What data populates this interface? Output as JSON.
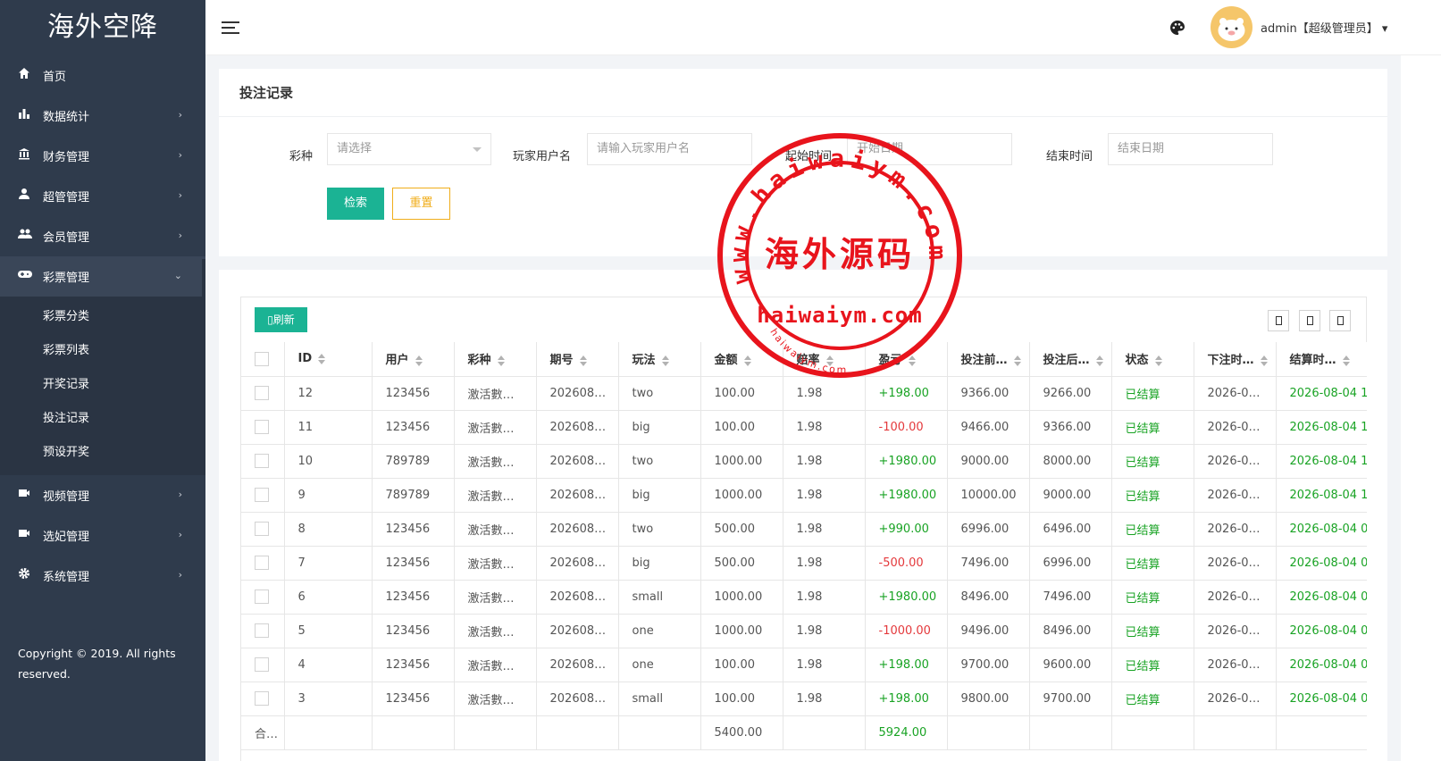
{
  "brand": "海外空降",
  "sidebar": {
    "items": [
      {
        "label": "首页",
        "icon": "home-icon",
        "arrow": ""
      },
      {
        "label": "数据统计",
        "icon": "bar-chart-icon",
        "arrow": "›"
      },
      {
        "label": "财务管理",
        "icon": "bank-icon",
        "arrow": "›"
      },
      {
        "label": "超管管理",
        "icon": "user-icon",
        "arrow": "›"
      },
      {
        "label": "会员管理",
        "icon": "users-icon",
        "arrow": "›"
      },
      {
        "label": "彩票管理",
        "icon": "gamepad-icon",
        "arrow": "⌄"
      }
    ],
    "sub_items": [
      "彩票分类",
      "彩票列表",
      "开奖记录",
      "投注记录",
      "预设开奖"
    ],
    "items_after": [
      {
        "label": "视频管理",
        "icon": "video-icon",
        "arrow": "›"
      },
      {
        "label": "选妃管理",
        "icon": "camera-icon",
        "arrow": "›"
      },
      {
        "label": "系统管理",
        "icon": "gear-icon",
        "arrow": "›"
      }
    ],
    "copyright": "Copyright © 2019. All rights reserved."
  },
  "header": {
    "admin": "admin【超级管理员】",
    "dropdown_arrow": "▾"
  },
  "search": {
    "title": "投注记录",
    "lottery_label": "彩种",
    "lottery_placeholder": "请选择",
    "user_label": "玩家用户名",
    "user_placeholder": "请输入玩家用户名",
    "start_label": "起始时间",
    "start_placeholder": "开始日期",
    "end_label": "结束时间",
    "end_placeholder": "结束日期",
    "search_button": "检索",
    "reset_button": "重置"
  },
  "table": {
    "refresh_label": "刷新",
    "columns": [
      "ID",
      "用户",
      "彩种",
      "期号",
      "玩法",
      "金额",
      "赔率",
      "盈亏",
      "投注前…",
      "投注后…",
      "状态",
      "下注时…",
      "结算时…"
    ],
    "rows": [
      [
        "12",
        "123456",
        "激活數…",
        "202608…",
        "two",
        "100.00",
        "1.98",
        "+198.00",
        "9366.00",
        "9266.00",
        "已结算",
        "2026-0…",
        "2026-08-04 1"
      ],
      [
        "11",
        "123456",
        "激活數…",
        "202608…",
        "big",
        "100.00",
        "1.98",
        "-100.00",
        "9466.00",
        "9366.00",
        "已结算",
        "2026-0…",
        "2026-08-04 1"
      ],
      [
        "10",
        "789789",
        "激活數…",
        "202608…",
        "two",
        "1000.00",
        "1.98",
        "+1980.00",
        "9000.00",
        "8000.00",
        "已结算",
        "2026-0…",
        "2026-08-04 1"
      ],
      [
        "9",
        "789789",
        "激活數…",
        "202608…",
        "big",
        "1000.00",
        "1.98",
        "+1980.00",
        "10000.00",
        "9000.00",
        "已结算",
        "2026-0…",
        "2026-08-04 1"
      ],
      [
        "8",
        "123456",
        "激活數…",
        "202608…",
        "two",
        "500.00",
        "1.98",
        "+990.00",
        "6996.00",
        "6496.00",
        "已结算",
        "2026-0…",
        "2026-08-04 0"
      ],
      [
        "7",
        "123456",
        "激活數…",
        "202608…",
        "big",
        "500.00",
        "1.98",
        "-500.00",
        "7496.00",
        "6996.00",
        "已结算",
        "2026-0…",
        "2026-08-04 0"
      ],
      [
        "6",
        "123456",
        "激活數…",
        "202608…",
        "small",
        "1000.00",
        "1.98",
        "+1980.00",
        "8496.00",
        "7496.00",
        "已结算",
        "2026-0…",
        "2026-08-04 0"
      ],
      [
        "5",
        "123456",
        "激活數…",
        "202608…",
        "one",
        "1000.00",
        "1.98",
        "-1000.00",
        "9496.00",
        "8496.00",
        "已结算",
        "2026-0…",
        "2026-08-04 0"
      ],
      [
        "4",
        "123456",
        "激活數…",
        "202608…",
        "one",
        "100.00",
        "1.98",
        "+198.00",
        "9700.00",
        "9600.00",
        "已结算",
        "2026-0…",
        "2026-08-04 0"
      ],
      [
        "3",
        "123456",
        "激活數…",
        "202608…",
        "small",
        "100.00",
        "1.98",
        "+198.00",
        "9800.00",
        "9700.00",
        "已结算",
        "2026-0…",
        "2026-08-04 0"
      ]
    ],
    "total_label": "合…",
    "total_amount": "5400.00",
    "total_profit": "5924.00"
  },
  "watermark": {
    "top_text": "www.haiwaiym.com",
    "center_text": "海外源码",
    "bottom_text": "haiwaiym.com",
    "small_text": "haiwaiym.com"
  },
  "colors": {
    "sidebar": "#2f3b4c",
    "accent": "#1bb394",
    "warning": "#f0ad1a",
    "positive": "#19a324",
    "negative": "#e4393c",
    "stamp": "#e8141c"
  }
}
